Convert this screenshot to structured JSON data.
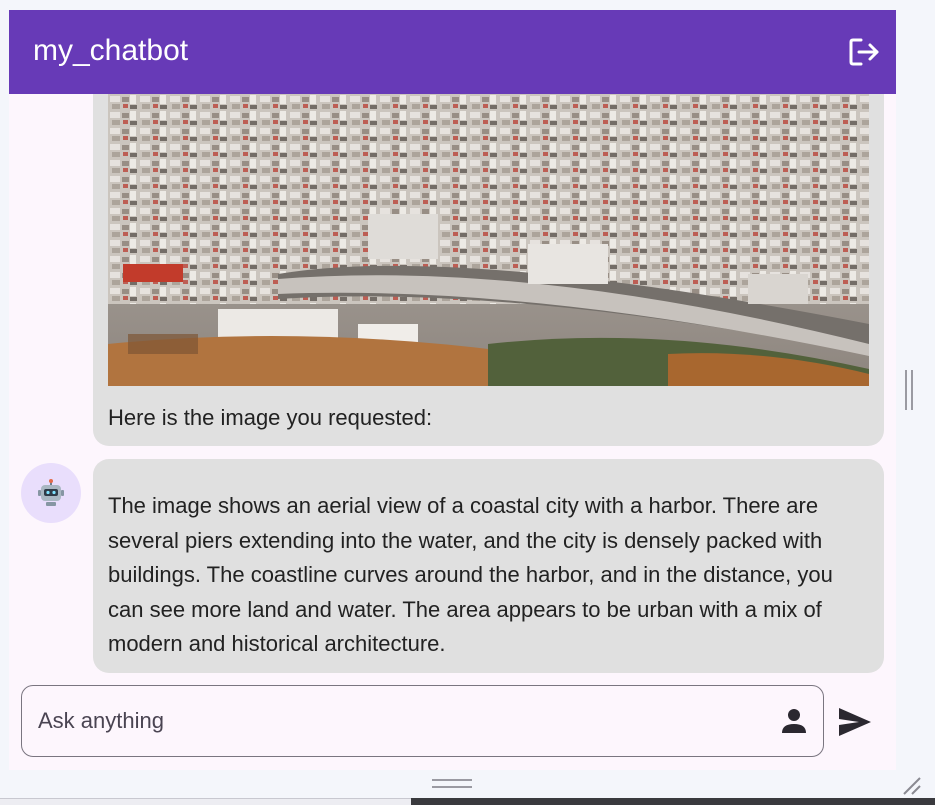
{
  "app": {
    "title": "my_chatbot",
    "icons": {
      "logout": "logout-icon",
      "bot": "robot-icon",
      "person": "person-icon",
      "send": "send-icon"
    },
    "colors": {
      "appbar": "#673ab7",
      "bubble": "#e0e0e0",
      "background": "#fdf6fd",
      "avatar": "#e9defc"
    }
  },
  "messages": [
    {
      "role": "assistant",
      "has_image": true,
      "text": "Here is the image you requested:"
    },
    {
      "role": "assistant",
      "text": "The image shows an aerial view of a coastal city with a harbor. There are several piers extending into the water, and the city is densely packed with buildings. The coastline curves around the harbor, and in the distance, you can see more land and water. The area appears to be urban with a mix of modern and historical architecture."
    }
  ],
  "composer": {
    "placeholder": "Ask anything",
    "value": ""
  }
}
